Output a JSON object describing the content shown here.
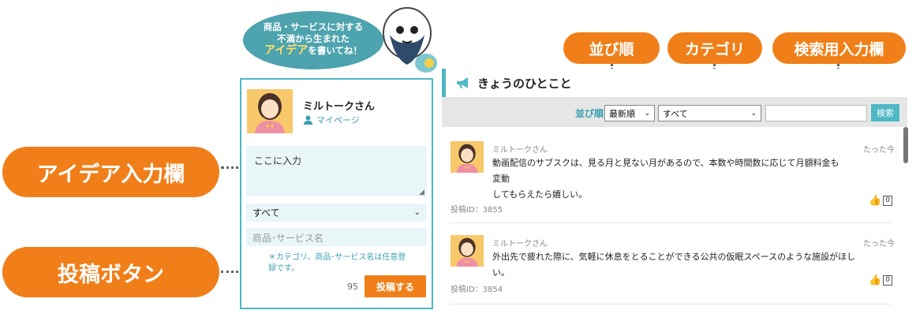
{
  "callouts": {
    "idea_input": "アイデア入力欄",
    "post_button": "投稿ボタン",
    "sort": "並び順",
    "category": "カテゴリ",
    "search": "検索用入力欄"
  },
  "bubble": {
    "line1": "商品・サービスに対する",
    "line2": "不満から生まれた",
    "highlight": "アイデア",
    "line3_rest": "を書いてね！"
  },
  "post_form": {
    "user_name": "ミルトークさん",
    "user_suffix": "さん",
    "mypage_label": "マイページ",
    "idea_placeholder": "ここに入力",
    "category_value": "すべて",
    "product_placeholder": "商品･サービス名",
    "note": "＊カテゴリ、商品･サービス名は任意登録です。",
    "char_count": "95",
    "submit_label": "投稿する"
  },
  "feed": {
    "title": "きょうのひとこと",
    "sort_label": "並び順",
    "sort_value": "最新順",
    "category_value": "すべて",
    "search_button": "検索",
    "posts": [
      {
        "name": "ミルトークさん",
        "time": "たった今",
        "body_line1": "動画配信のサブスクは、見る月と見ない月があるので、本数や時間数に応じて月額料金も変動",
        "body_line2": "してもらえたら嬉しい。",
        "post_id": "投稿ID：3855",
        "likes": "0"
      },
      {
        "name": "ミルトークさん",
        "time": "たった今",
        "body_line1": "外出先で疲れた際に、気軽に休息をとることができる公共の仮眠スペースのような施設がほしい。",
        "body_line2": "",
        "post_id": "投稿ID：3854",
        "likes": "0"
      }
    ]
  },
  "colors": {
    "accent_orange": "#f07f19",
    "accent_teal": "#4cb8c4",
    "input_bg": "#e9f6f8"
  }
}
